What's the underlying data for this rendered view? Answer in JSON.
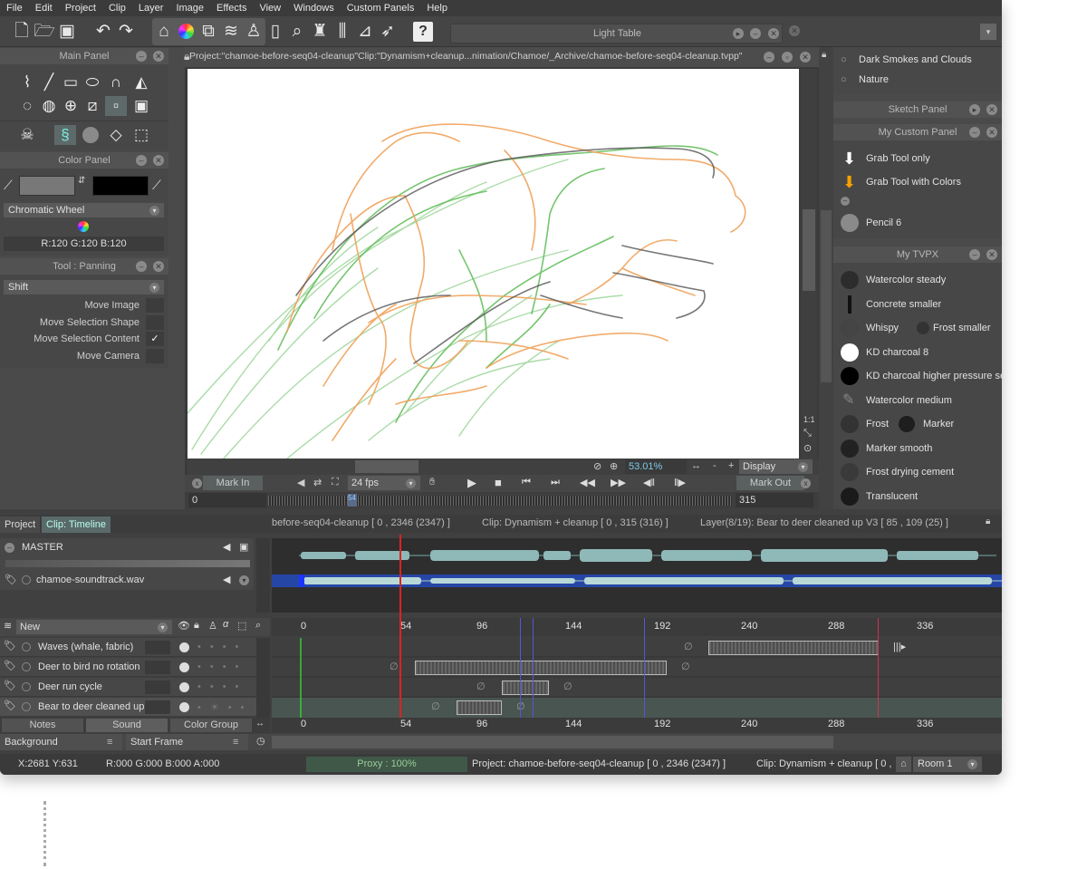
{
  "menu": [
    "File",
    "Edit",
    "Project",
    "Clip",
    "Layer",
    "Image",
    "Effects",
    "View",
    "Windows",
    "Custom Panels",
    "Help"
  ],
  "light_table": {
    "title": "Light Table"
  },
  "main_panel": {
    "title": "Main Panel"
  },
  "canvas": {
    "title": "Project:\"chamoe-before-seq04-cleanup\"Clip:\"Dynamism+cleanup...nimation/Chamoe/_Archive/chamoe-before-seq04-cleanup.tvpp\"",
    "zoom": "53.01%",
    "display": "Display",
    "zoom_minus": "-",
    "zoom_plus": "+",
    "fit": "1:1"
  },
  "color_panel": {
    "title": "Color Panel",
    "mode": "Chromatic Wheel",
    "rgb": "R:120 G:120 B:120"
  },
  "tool_panel": {
    "title": "Tool : Panning",
    "modifier": "Shift",
    "options": [
      {
        "label": "Move Image",
        "checked": ""
      },
      {
        "label": "Move Selection Shape",
        "checked": ""
      },
      {
        "label": "Move Selection Content",
        "checked": "✓"
      },
      {
        "label": "Move Camera",
        "checked": ""
      }
    ]
  },
  "right_panel": {
    "top_items": [
      "Dark Smokes and Clouds",
      "Nature"
    ],
    "sketch_title": "Sketch Panel",
    "custom_title": "My Custom Panel",
    "custom_items": [
      "Grab Tool only",
      "Grab Tool with Colors",
      "Pencil 6"
    ],
    "tvpx_title": "My TVPX",
    "tvpx_items": [
      {
        "label": "Watercolor steady",
        "label2": ""
      },
      {
        "label": "Concrete smaller",
        "label2": ""
      },
      {
        "label": "Whispy",
        "label2": "Frost smaller"
      },
      {
        "label": "KD charcoal 8",
        "label2": ""
      },
      {
        "label": "KD charcoal higher pressure se",
        "label2": ""
      },
      {
        "label": "Watercolor medium",
        "label2": ""
      },
      {
        "label": "Frost",
        "label2": "Marker"
      },
      {
        "label": "Marker smooth",
        "label2": ""
      },
      {
        "label": "Frost drying cement",
        "label2": ""
      },
      {
        "label": "Translucent",
        "label2": ""
      }
    ]
  },
  "playback": {
    "mark_in": "Mark In",
    "mark_out": "Mark Out",
    "fps": "24 fps",
    "start": "0",
    "end": "315",
    "current": "54"
  },
  "timeline": {
    "tab_project": "Project",
    "tab_clip": "Clip: Timeline",
    "info_project": "before-seq04-cleanup [ 0 , 2346  (2347) ]",
    "info_clip": "Clip: Dynamism + cleanup [ 0 , 315  (316) ]",
    "info_layer": "Layer(8/19): Bear to deer cleaned up V3 [ 85 , 109  (25) ]",
    "master": "MASTER",
    "sound": "chamoe-soundtrack.wav",
    "new_layer": "New",
    "layers": [
      "Waves (whale, fabric)",
      "Deer to bird no rotation",
      "Deer run cycle",
      "Bear to deer cleaned up"
    ],
    "ruler": [
      "0",
      "54",
      "96",
      "144",
      "192",
      "240",
      "288",
      "336"
    ],
    "bottom_tabs": [
      "Notes",
      "Sound",
      "Color Group"
    ],
    "background": "Background",
    "start_frame": "Start Frame"
  },
  "status": {
    "coords": "X:2681  Y:631",
    "color": "R:000 G:000 B:000 A:000",
    "proxy": "Proxy : 100%",
    "project": "Project: chamoe-before-seq04-cleanup [ 0 , 2346  (2347) ]",
    "clip": "Clip: Dynamism + cleanup [ 0 ,",
    "room": "Room 1"
  }
}
